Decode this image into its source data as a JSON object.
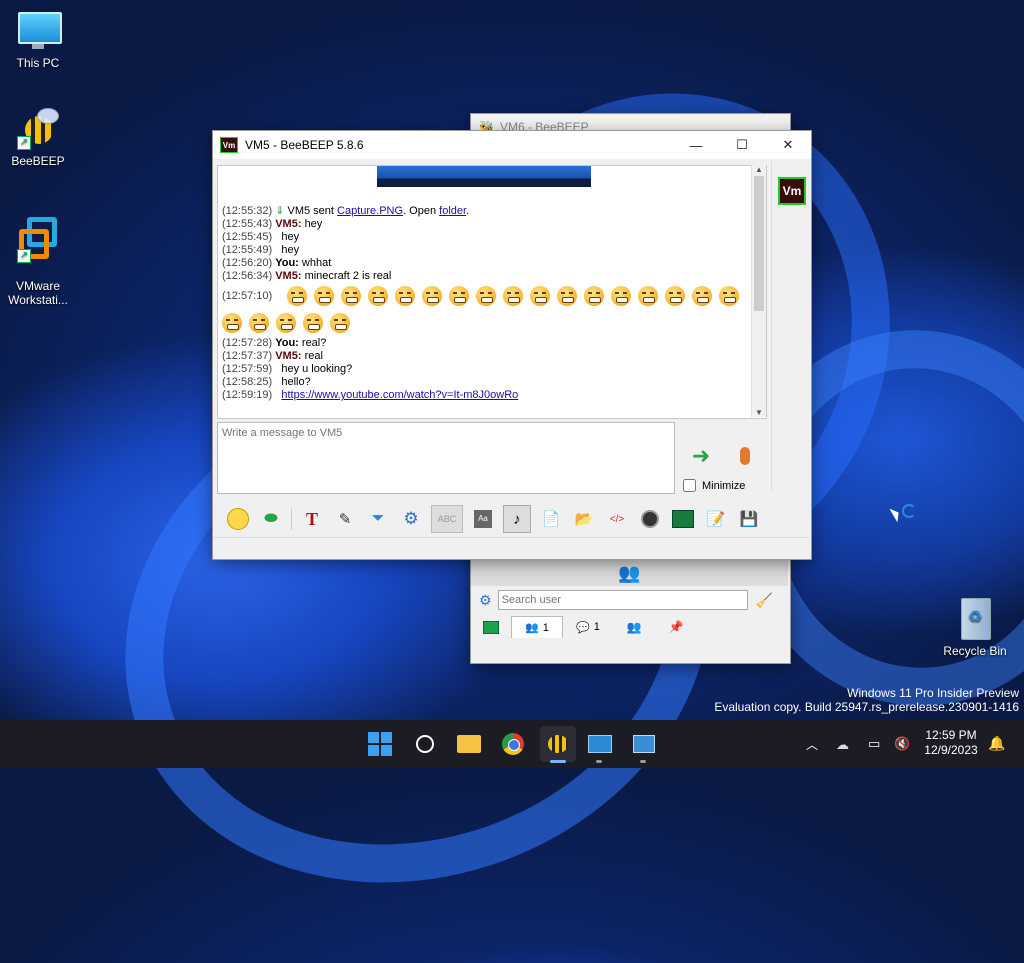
{
  "desktop": {
    "icons": [
      {
        "label": "This PC"
      },
      {
        "label": "BeeBEEP"
      },
      {
        "label": "VMware\nWorkstati..."
      },
      {
        "label": "Recycle Bin"
      }
    ],
    "watermark": {
      "line1": "Windows 11 Pro Insider Preview",
      "line2": "Evaluation copy. Build 25947.rs_prerelease.230901-1416"
    }
  },
  "back_window": {
    "title": "VM6 - BeeBEEP",
    "search_placeholder": "Search user",
    "tabs": [
      {
        "icon": "users-icon",
        "count": "1"
      },
      {
        "icon": "chat-icon",
        "count": "1"
      },
      {
        "icon": "group-icon",
        "count": ""
      },
      {
        "icon": "pin-icon",
        "count": ""
      }
    ]
  },
  "chat_window": {
    "title": "VM5 - BeeBEEP 5.8.6",
    "avatar_label": "Vm",
    "messages": [
      {
        "time": "(12:55:32)",
        "sender": "",
        "text": "VM5 sent ",
        "link": "Capture.PNG",
        "text2": ". Open ",
        "link2": "folder",
        "text3": "."
      },
      {
        "time": "(12:55:43)",
        "sender": "VM5:",
        "text": "hey"
      },
      {
        "time": "(12:55:45)",
        "sender": "",
        "text": "hey"
      },
      {
        "time": "(12:55:49)",
        "sender": "",
        "text": "hey"
      },
      {
        "time": "(12:56:20)",
        "sender": "You:",
        "text": "whhat"
      },
      {
        "time": "(12:56:34)",
        "sender": "VM5:",
        "text": "minecraft 2 is real"
      },
      {
        "time": "(12:57:10)",
        "sender": "",
        "text": ""
      },
      {
        "time": "(12:57:28)",
        "sender": "You:",
        "text": "real?"
      },
      {
        "time": "(12:57:37)",
        "sender": "VM5:",
        "text": "real"
      },
      {
        "time": "(12:57:59)",
        "sender": "",
        "text": "hey u looking?"
      },
      {
        "time": "(12:58:25)",
        "sender": "",
        "text": "hello?"
      },
      {
        "time": "(12:59:19)",
        "sender": "",
        "link": "https://www.youtube.com/watch?v=It-m8J0owRo"
      }
    ],
    "emoji_count": 22,
    "input_placeholder": "Write a message to VM5",
    "minimize_label": "Minimize"
  },
  "taskbar": {
    "time": "12:59 PM",
    "date": "12/9/2023"
  }
}
